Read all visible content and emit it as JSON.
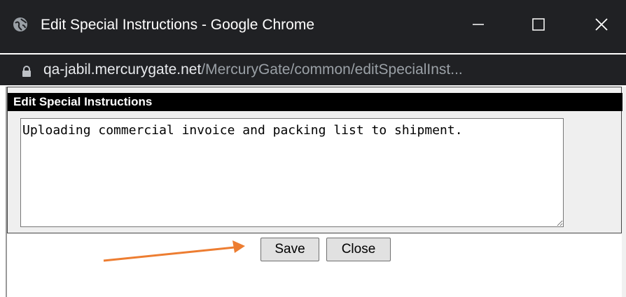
{
  "window": {
    "title": "Edit Special Instructions - Google Chrome",
    "url_host": "qa-jabil.mercurygate.net",
    "url_path": "/MercuryGate/common/editSpecialInst...",
    "controls": [
      "minimize-icon",
      "maximize-icon",
      "close-icon"
    ]
  },
  "panel": {
    "header": "Edit Special Instructions",
    "textarea_value": "Uploading commercial invoice and packing list to shipment."
  },
  "buttons": {
    "save_label": "Save",
    "close_label": "Close"
  },
  "colors": {
    "titlebar": "#202124",
    "annotation_arrow": "#ed7d31"
  }
}
